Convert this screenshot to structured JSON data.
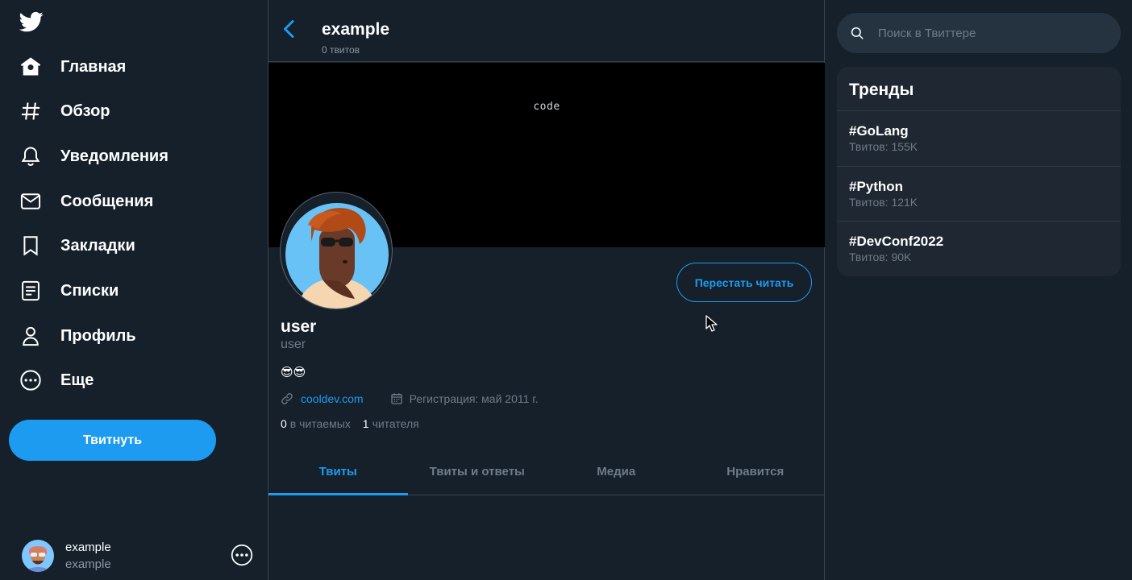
{
  "nav": {
    "items": [
      {
        "label": "Главная",
        "icon": "home-icon"
      },
      {
        "label": "Обзор",
        "icon": "hashtag-icon"
      },
      {
        "label": "Уведомления",
        "icon": "bell-icon"
      },
      {
        "label": "Сообщения",
        "icon": "mail-icon"
      },
      {
        "label": "Закладки",
        "icon": "bookmark-icon"
      },
      {
        "label": "Списки",
        "icon": "list-icon"
      },
      {
        "label": "Профиль",
        "icon": "user-icon"
      },
      {
        "label": "Еще",
        "icon": "more-circle-icon"
      }
    ],
    "tweet_button": "Твитнуть"
  },
  "account": {
    "name": "example",
    "handle": "example"
  },
  "header": {
    "title": "example",
    "subtitle": "0 твитов"
  },
  "banner": {
    "text": "code"
  },
  "profile": {
    "name": "user",
    "handle": "user",
    "bio": "😎😎",
    "website": "cooldev.com",
    "joined": "Регистрация: май 2011 г.",
    "following_count": "0",
    "following_label": "в читаемых",
    "followers_count": "1",
    "followers_label": "читателя",
    "follow_button": "Перестать читать"
  },
  "tabs": [
    {
      "label": "Твиты",
      "active": true
    },
    {
      "label": "Твиты и ответы",
      "active": false
    },
    {
      "label": "Медиа",
      "active": false
    },
    {
      "label": "Нравится",
      "active": false
    }
  ],
  "search": {
    "placeholder": "Поиск в Твиттере"
  },
  "trends": {
    "title": "Тренды",
    "items": [
      {
        "tag": "#GoLang",
        "count": "Твитов: 155K"
      },
      {
        "tag": "#Python",
        "count": "Твитов: 121K"
      },
      {
        "tag": "#DevConf2022",
        "count": "Твитов: 90K"
      }
    ]
  },
  "colors": {
    "background": "#15202b",
    "accent": "#1d9bf0",
    "border": "#38444d",
    "muted_text": "#6e7b88",
    "card": "#1e2732"
  }
}
